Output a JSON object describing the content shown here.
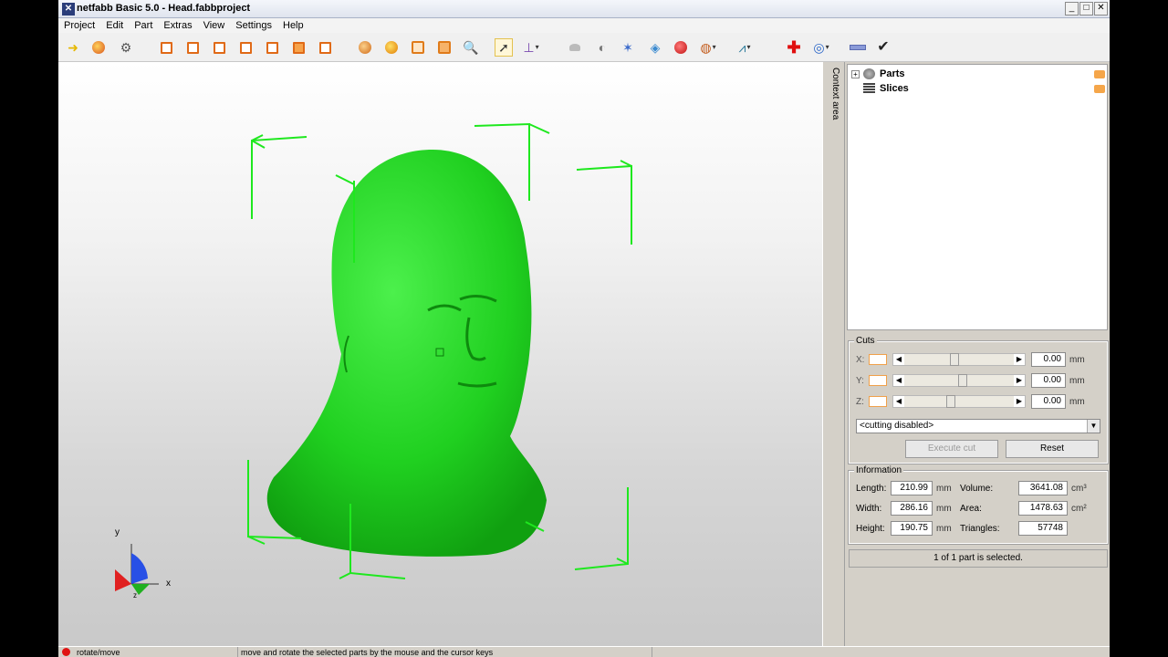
{
  "window": {
    "title": "netfabb Basic 5.0 - Head.fabbproject",
    "controls": [
      "minimize-icon",
      "maximize-icon",
      "close-icon"
    ]
  },
  "menu": [
    "Project",
    "Edit",
    "Part",
    "Extras",
    "View",
    "Settings",
    "Help"
  ],
  "toolbar": {
    "icons": [
      "open-icon",
      "add-part-icon",
      "settings-icon",
      "view-front-icon",
      "view-back-icon",
      "view-left-icon",
      "view-right-icon",
      "view-top-icon",
      "view-bottom-icon",
      "zoom-to-part-icon",
      "zoom-selection-icon",
      "zoom-all-icon",
      "zoom-window-icon",
      "magnifier-icon",
      "select-pointer-icon",
      "move-axes-icon",
      "shading-icon",
      "light-icon",
      "measure-icon",
      "triangles-icon",
      "color-icon",
      "slice-icon",
      "support-icon",
      "repair-plus-icon",
      "analysis-icon",
      "ruler-icon",
      "checkmark-icon"
    ]
  },
  "side_tab": "Context area",
  "tree": {
    "items": [
      {
        "label": "Parts",
        "icon": "parts-icon"
      },
      {
        "label": "Slices",
        "icon": "slices-icon"
      }
    ]
  },
  "cuts": {
    "title": "Cuts",
    "rows": [
      {
        "axis": "X:",
        "value": "0.00",
        "unit": "mm",
        "position": 0.45
      },
      {
        "axis": "Y:",
        "value": "0.00",
        "unit": "mm",
        "position": 0.53
      },
      {
        "axis": "Z:",
        "value": "0.00",
        "unit": "mm",
        "position": 0.41
      }
    ],
    "mode": "<cutting disabled>",
    "execute_label": "Execute cut",
    "reset_label": "Reset"
  },
  "info": {
    "title": "Information",
    "length_label": "Length:",
    "length": "210.99",
    "length_unit": "mm",
    "width_label": "Width:",
    "width": "286.16",
    "width_unit": "mm",
    "height_label": "Height:",
    "height": "190.75",
    "height_unit": "mm",
    "volume_label": "Volume:",
    "volume": "3641.08",
    "volume_unit": "cm³",
    "area_label": "Area:",
    "area": "1478.63",
    "area_unit": "cm²",
    "triangles_label": "Triangles:",
    "triangles": "57748"
  },
  "selection_status": "1 of 1 part is selected.",
  "statusbar": {
    "mode": "rotate/move",
    "hint": "move and rotate the selected parts by the mouse and the cursor keys"
  },
  "axes": {
    "y": "y",
    "x": "x",
    "z": "z"
  },
  "colors": {
    "model": "#22cc22",
    "bbox": "#1ee81e",
    "cut_check": "#f0a04a"
  }
}
